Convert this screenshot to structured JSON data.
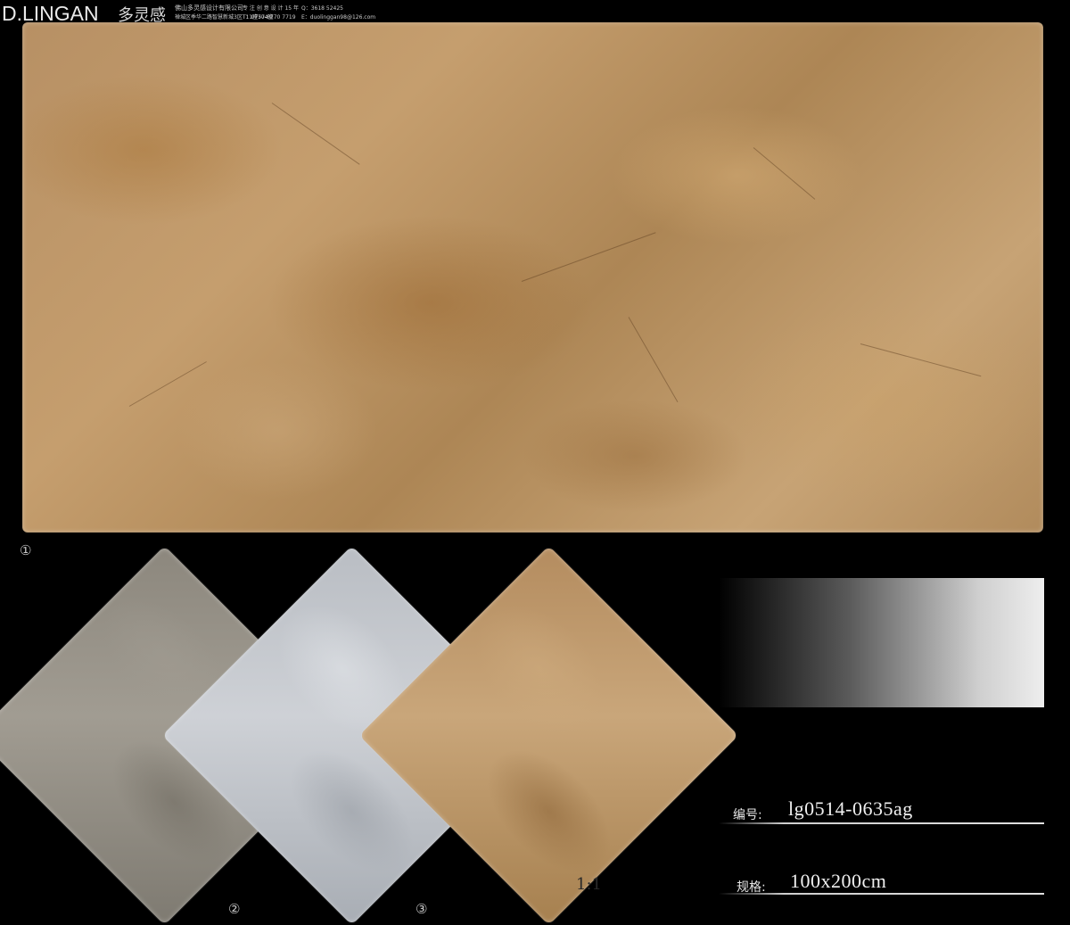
{
  "header": {
    "brand": "D.LINGAN",
    "brand_cn": "多灵感",
    "company": "佛山多灵感设计有限公司",
    "address": "禅城区季华二路智慧新城3区T11座704室",
    "slogan": "专 注 创 意 设 计 15 年",
    "tel": "T：0757-8270 7719",
    "qq": "Q：3618 52425",
    "email": "E：duolinggan98@126.com"
  },
  "labels": {
    "main_num": "①",
    "tile2_num": "②",
    "tile3_num": "③",
    "scale": "1:1"
  },
  "specs": {
    "code_label": "编号:",
    "code_value": "lg0514-0635ag",
    "size_label": "规格:",
    "size_value": "100x200cm"
  },
  "tiles": [
    {
      "name": "grey",
      "color": "#8c877d"
    },
    {
      "name": "light-grey",
      "color": "#c3c7cc"
    },
    {
      "name": "beige",
      "color": "#b99265"
    }
  ]
}
